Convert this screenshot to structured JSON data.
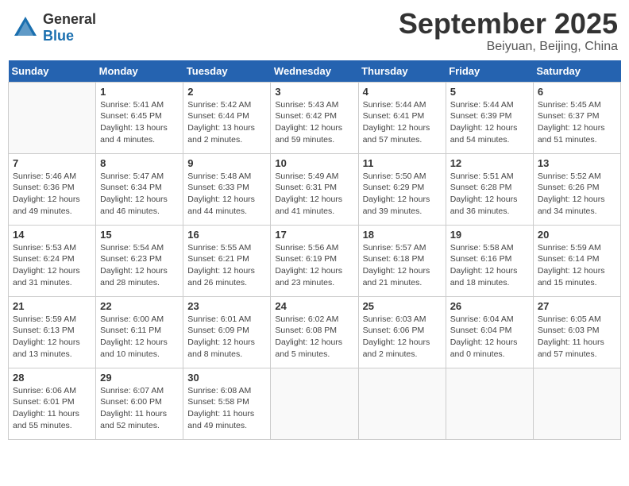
{
  "header": {
    "logo_general": "General",
    "logo_blue": "Blue",
    "month": "September 2025",
    "location": "Beiyuan, Beijing, China"
  },
  "weekdays": [
    "Sunday",
    "Monday",
    "Tuesday",
    "Wednesday",
    "Thursday",
    "Friday",
    "Saturday"
  ],
  "weeks": [
    [
      {
        "day": "",
        "info": ""
      },
      {
        "day": "1",
        "info": "Sunrise: 5:41 AM\nSunset: 6:45 PM\nDaylight: 13 hours\nand 4 minutes."
      },
      {
        "day": "2",
        "info": "Sunrise: 5:42 AM\nSunset: 6:44 PM\nDaylight: 13 hours\nand 2 minutes."
      },
      {
        "day": "3",
        "info": "Sunrise: 5:43 AM\nSunset: 6:42 PM\nDaylight: 12 hours\nand 59 minutes."
      },
      {
        "day": "4",
        "info": "Sunrise: 5:44 AM\nSunset: 6:41 PM\nDaylight: 12 hours\nand 57 minutes."
      },
      {
        "day": "5",
        "info": "Sunrise: 5:44 AM\nSunset: 6:39 PM\nDaylight: 12 hours\nand 54 minutes."
      },
      {
        "day": "6",
        "info": "Sunrise: 5:45 AM\nSunset: 6:37 PM\nDaylight: 12 hours\nand 51 minutes."
      }
    ],
    [
      {
        "day": "7",
        "info": "Sunrise: 5:46 AM\nSunset: 6:36 PM\nDaylight: 12 hours\nand 49 minutes."
      },
      {
        "day": "8",
        "info": "Sunrise: 5:47 AM\nSunset: 6:34 PM\nDaylight: 12 hours\nand 46 minutes."
      },
      {
        "day": "9",
        "info": "Sunrise: 5:48 AM\nSunset: 6:33 PM\nDaylight: 12 hours\nand 44 minutes."
      },
      {
        "day": "10",
        "info": "Sunrise: 5:49 AM\nSunset: 6:31 PM\nDaylight: 12 hours\nand 41 minutes."
      },
      {
        "day": "11",
        "info": "Sunrise: 5:50 AM\nSunset: 6:29 PM\nDaylight: 12 hours\nand 39 minutes."
      },
      {
        "day": "12",
        "info": "Sunrise: 5:51 AM\nSunset: 6:28 PM\nDaylight: 12 hours\nand 36 minutes."
      },
      {
        "day": "13",
        "info": "Sunrise: 5:52 AM\nSunset: 6:26 PM\nDaylight: 12 hours\nand 34 minutes."
      }
    ],
    [
      {
        "day": "14",
        "info": "Sunrise: 5:53 AM\nSunset: 6:24 PM\nDaylight: 12 hours\nand 31 minutes."
      },
      {
        "day": "15",
        "info": "Sunrise: 5:54 AM\nSunset: 6:23 PM\nDaylight: 12 hours\nand 28 minutes."
      },
      {
        "day": "16",
        "info": "Sunrise: 5:55 AM\nSunset: 6:21 PM\nDaylight: 12 hours\nand 26 minutes."
      },
      {
        "day": "17",
        "info": "Sunrise: 5:56 AM\nSunset: 6:19 PM\nDaylight: 12 hours\nand 23 minutes."
      },
      {
        "day": "18",
        "info": "Sunrise: 5:57 AM\nSunset: 6:18 PM\nDaylight: 12 hours\nand 21 minutes."
      },
      {
        "day": "19",
        "info": "Sunrise: 5:58 AM\nSunset: 6:16 PM\nDaylight: 12 hours\nand 18 minutes."
      },
      {
        "day": "20",
        "info": "Sunrise: 5:59 AM\nSunset: 6:14 PM\nDaylight: 12 hours\nand 15 minutes."
      }
    ],
    [
      {
        "day": "21",
        "info": "Sunrise: 5:59 AM\nSunset: 6:13 PM\nDaylight: 12 hours\nand 13 minutes."
      },
      {
        "day": "22",
        "info": "Sunrise: 6:00 AM\nSunset: 6:11 PM\nDaylight: 12 hours\nand 10 minutes."
      },
      {
        "day": "23",
        "info": "Sunrise: 6:01 AM\nSunset: 6:09 PM\nDaylight: 12 hours\nand 8 minutes."
      },
      {
        "day": "24",
        "info": "Sunrise: 6:02 AM\nSunset: 6:08 PM\nDaylight: 12 hours\nand 5 minutes."
      },
      {
        "day": "25",
        "info": "Sunrise: 6:03 AM\nSunset: 6:06 PM\nDaylight: 12 hours\nand 2 minutes."
      },
      {
        "day": "26",
        "info": "Sunrise: 6:04 AM\nSunset: 6:04 PM\nDaylight: 12 hours\nand 0 minutes."
      },
      {
        "day": "27",
        "info": "Sunrise: 6:05 AM\nSunset: 6:03 PM\nDaylight: 11 hours\nand 57 minutes."
      }
    ],
    [
      {
        "day": "28",
        "info": "Sunrise: 6:06 AM\nSunset: 6:01 PM\nDaylight: 11 hours\nand 55 minutes."
      },
      {
        "day": "29",
        "info": "Sunrise: 6:07 AM\nSunset: 6:00 PM\nDaylight: 11 hours\nand 52 minutes."
      },
      {
        "day": "30",
        "info": "Sunrise: 6:08 AM\nSunset: 5:58 PM\nDaylight: 11 hours\nand 49 minutes."
      },
      {
        "day": "",
        "info": ""
      },
      {
        "day": "",
        "info": ""
      },
      {
        "day": "",
        "info": ""
      },
      {
        "day": "",
        "info": ""
      }
    ]
  ]
}
